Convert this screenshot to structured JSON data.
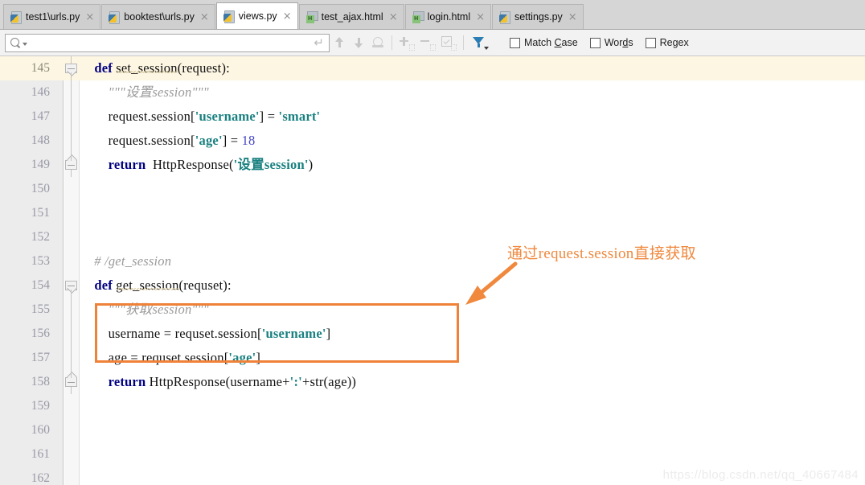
{
  "window": {
    "title": "views.py",
    "watermark": "https://blog.csdn.net/qq_40667484"
  },
  "tabs": [
    {
      "label": "test1\\urls.py",
      "icon": "python-file-icon",
      "type": "py",
      "active": false,
      "close": "×"
    },
    {
      "label": "booktest\\urls.py",
      "icon": "python-file-icon",
      "type": "py",
      "active": false,
      "close": "×"
    },
    {
      "label": "views.py",
      "icon": "python-file-icon",
      "type": "py",
      "active": true,
      "close": "×"
    },
    {
      "label": "test_ajax.html",
      "icon": "html-file-icon",
      "type": "html",
      "active": false,
      "close": "×"
    },
    {
      "label": "login.html",
      "icon": "html-file-icon",
      "type": "html",
      "active": false,
      "close": "×"
    },
    {
      "label": "settings.py",
      "icon": "python-file-icon",
      "type": "py",
      "active": false,
      "close": "×"
    }
  ],
  "findbar": {
    "search_value": "",
    "search_placeholder": "",
    "search_icon": "search-icon",
    "search_dropdown_icon": "chevron-down-icon",
    "enter_hint_glyph": "↵",
    "prev_match_icon": "arrow-up-icon",
    "next_match_icon": "arrow-down-icon",
    "find_all_icon": "find-all-icon",
    "add_icon": "add-selection-icon",
    "remove_icon": "remove-selection-icon",
    "select_all_icon": "select-all-occurrences-icon",
    "filter_icon": "filter-icon",
    "options": [
      {
        "label": "Match Case",
        "pre": "Match ",
        "mnemonic": "C",
        "post": "ase",
        "checked": false
      },
      {
        "label": "Words",
        "pre": "Wor",
        "mnemonic": "d",
        "post": "s",
        "checked": false
      },
      {
        "label": "Regex",
        "pre": "Re",
        "mnemonic": "g",
        "post": "ex",
        "checked": false
      }
    ]
  },
  "editor": {
    "language": "Python",
    "highlighted_line": 145,
    "first_line": 145,
    "lines": [
      {
        "num": "145",
        "highlight": true,
        "fold": "open",
        "tokens": [
          {
            "t": "    ",
            "c": "plain"
          },
          {
            "t": "def",
            "c": "kw"
          },
          {
            "t": " ",
            "c": "plain"
          },
          {
            "t": "set_session",
            "c": "plain-squiggle"
          },
          {
            "t": "(request):",
            "c": "plain"
          }
        ]
      },
      {
        "num": "146",
        "highlight": false,
        "fold": "",
        "tokens": [
          {
            "t": "        \"\"\"设置session\"\"\"",
            "c": "cmt"
          }
        ]
      },
      {
        "num": "147",
        "highlight": false,
        "fold": "",
        "tokens": [
          {
            "t": "        request.session[",
            "c": "plain"
          },
          {
            "t": "'username'",
            "c": "str"
          },
          {
            "t": "] = ",
            "c": "plain"
          },
          {
            "t": "'smart'",
            "c": "str"
          }
        ]
      },
      {
        "num": "148",
        "highlight": false,
        "fold": "",
        "tokens": [
          {
            "t": "        request.session[",
            "c": "plain"
          },
          {
            "t": "'age'",
            "c": "str"
          },
          {
            "t": "] = ",
            "c": "plain"
          },
          {
            "t": "18",
            "c": "num"
          }
        ]
      },
      {
        "num": "149",
        "highlight": false,
        "fold": "end",
        "tokens": [
          {
            "t": "        ",
            "c": "plain"
          },
          {
            "t": "return",
            "c": "kw"
          },
          {
            "t": "  HttpResponse(",
            "c": "plain"
          },
          {
            "t": "'设置session'",
            "c": "str"
          },
          {
            "t": ")",
            "c": "plain"
          }
        ]
      },
      {
        "num": "150",
        "highlight": false,
        "fold": "",
        "tokens": []
      },
      {
        "num": "151",
        "highlight": false,
        "fold": "",
        "tokens": []
      },
      {
        "num": "152",
        "highlight": false,
        "fold": "",
        "tokens": []
      },
      {
        "num": "153",
        "highlight": false,
        "fold": "",
        "tokens": [
          {
            "t": "    # /get_session",
            "c": "cmt"
          }
        ]
      },
      {
        "num": "154",
        "highlight": false,
        "fold": "open",
        "tokens": [
          {
            "t": "    ",
            "c": "plain"
          },
          {
            "t": "def",
            "c": "kw"
          },
          {
            "t": " ",
            "c": "plain"
          },
          {
            "t": "get_session",
            "c": "plain-squiggle"
          },
          {
            "t": "(requset):",
            "c": "plain"
          }
        ]
      },
      {
        "num": "155",
        "highlight": false,
        "fold": "",
        "tokens": [
          {
            "t": "        \"\"\"获取session\"\"\"",
            "c": "cmt"
          }
        ]
      },
      {
        "num": "156",
        "highlight": false,
        "fold": "",
        "tokens": [
          {
            "t": "        username = requset.session[",
            "c": "plain"
          },
          {
            "t": "'username'",
            "c": "str"
          },
          {
            "t": "]",
            "c": "plain"
          }
        ]
      },
      {
        "num": "157",
        "highlight": false,
        "fold": "",
        "tokens": [
          {
            "t": "        age = requset.session[",
            "c": "plain"
          },
          {
            "t": "'age'",
            "c": "str"
          },
          {
            "t": "]",
            "c": "plain"
          }
        ]
      },
      {
        "num": "158",
        "highlight": false,
        "fold": "end",
        "tokens": [
          {
            "t": "        ",
            "c": "plain"
          },
          {
            "t": "return",
            "c": "kw"
          },
          {
            "t": " HttpResponse(username+",
            "c": "plain"
          },
          {
            "t": "':'",
            "c": "str"
          },
          {
            "t": "+str(age))",
            "c": "plain"
          }
        ]
      },
      {
        "num": "159",
        "highlight": false,
        "fold": "",
        "tokens": []
      },
      {
        "num": "160",
        "highlight": false,
        "fold": "",
        "tokens": []
      },
      {
        "num": "161",
        "highlight": false,
        "fold": "",
        "tokens": []
      },
      {
        "num": "162",
        "highlight": false,
        "fold": "",
        "tokens": []
      }
    ]
  },
  "annotations": {
    "callout_text": "通过request.session直接获取",
    "callout_color": "#f0883d",
    "box_color": "#ef8138",
    "arrow_icon": "arrow-pointing-down-left-icon"
  },
  "colors": {
    "keyword": "#000080",
    "string": "#1a8080",
    "number": "#4646c8",
    "comment": "#9a9a9a",
    "highlight_line_bg": "#fdf6e3",
    "gutter_bg": "#ececec",
    "accent_orange": "#ef8138",
    "filter_blue": "#2a7eb5"
  }
}
